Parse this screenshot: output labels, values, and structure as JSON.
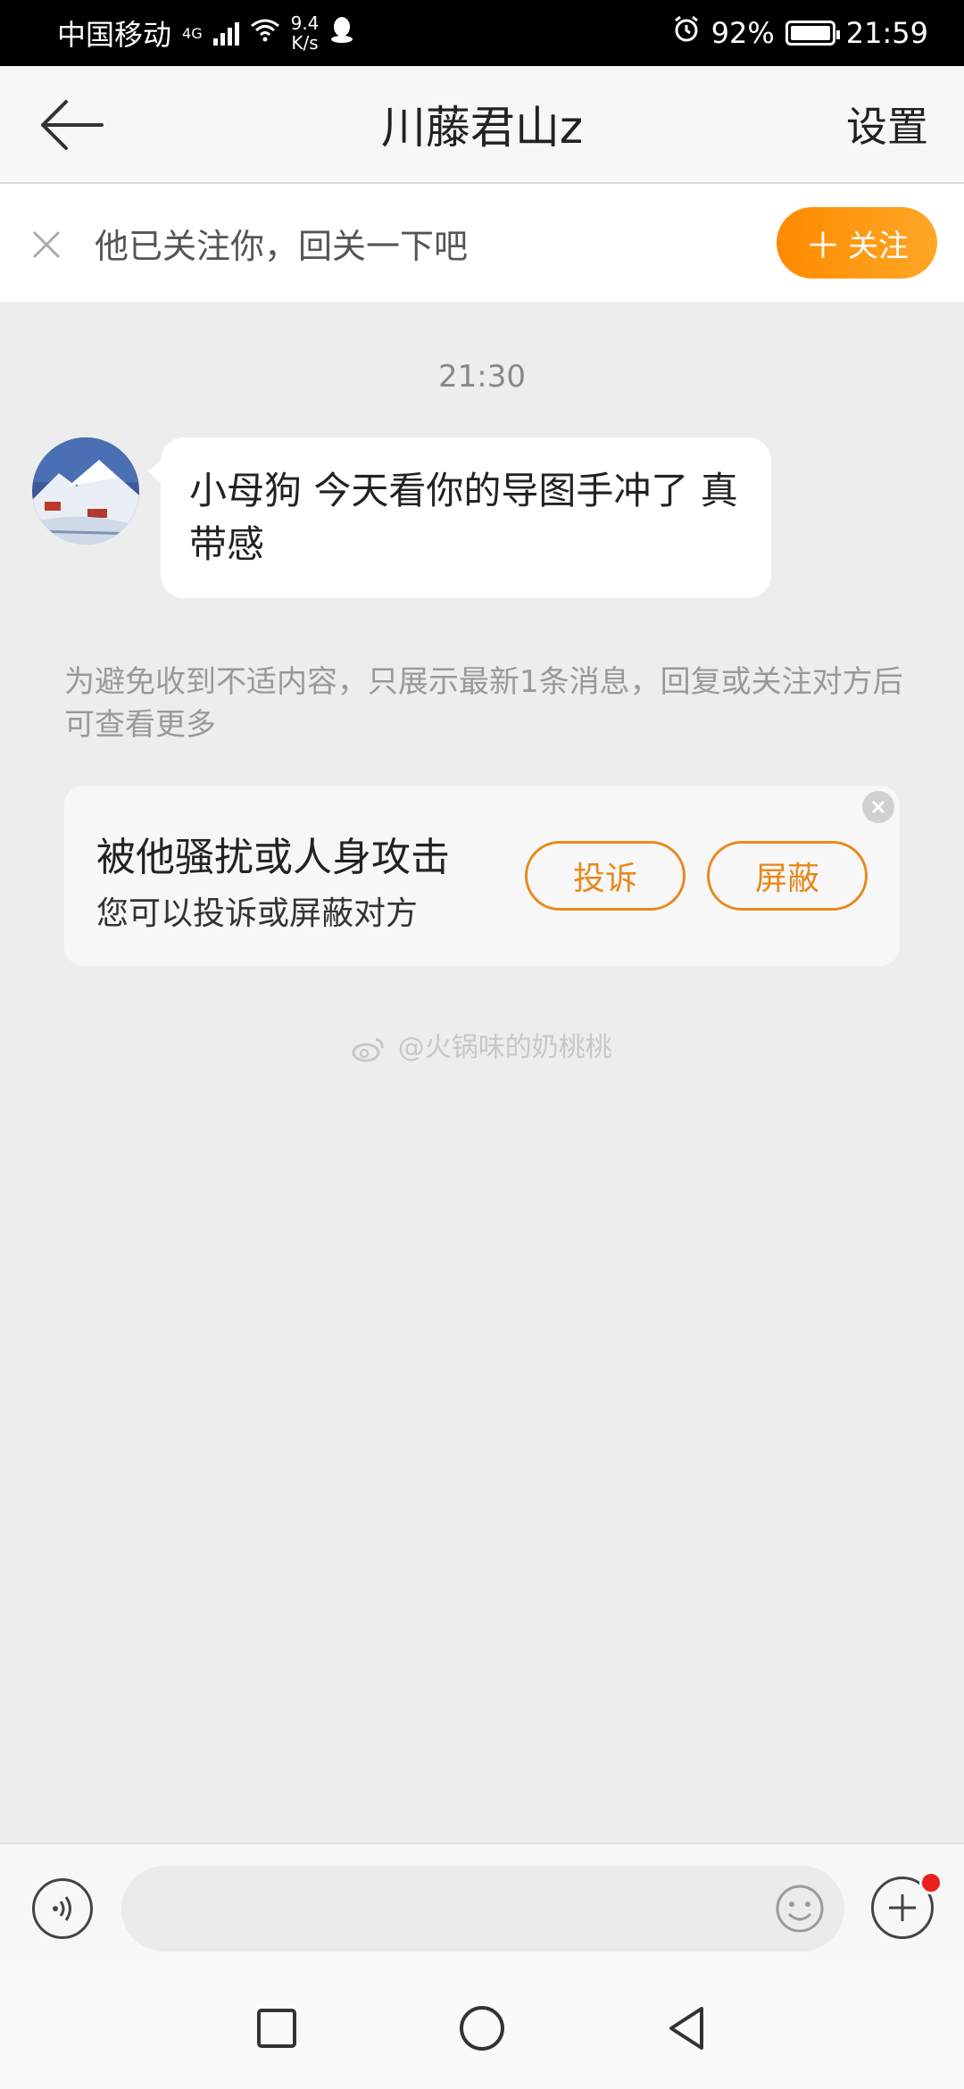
{
  "status_bar": {
    "carrier": "中国移动",
    "network": "4G",
    "speed_value": "9.4",
    "speed_unit": "K/s",
    "battery": "92%",
    "time": "21:59"
  },
  "header": {
    "title": "川藤君山z",
    "settings_label": "设置"
  },
  "follow_banner": {
    "text": "他已关注你，回关一下吧",
    "follow_label": "关注"
  },
  "chat": {
    "timestamp": "21:30",
    "messages": [
      {
        "text": "小母狗 今天看你的导图手冲了 真带感"
      }
    ],
    "notice": "为避免收到不适内容，只展示最新1条消息，回复或关注对方后可查看更多"
  },
  "report_card": {
    "title": "被他骚扰或人身攻击",
    "subtitle": "您可以投诉或屏蔽对方",
    "complain_label": "投诉",
    "block_label": "屏蔽"
  },
  "watermark": "@火锅味的奶桃桃",
  "input_bar": {
    "placeholder": ""
  },
  "colors": {
    "accent": "#ff8a00",
    "report_orange": "#e8891e",
    "notification_red": "#e9201d"
  }
}
